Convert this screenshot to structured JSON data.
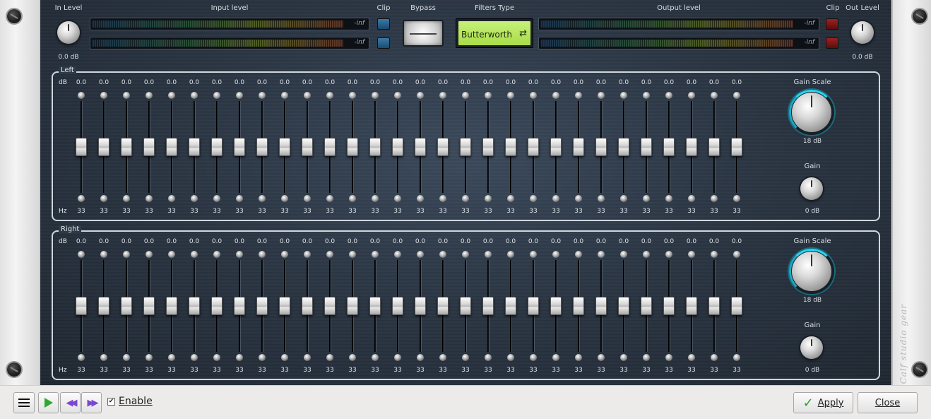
{
  "header": {
    "in_level_label": "In Level",
    "in_level_value": "0.0 dB",
    "input_level_label": "Input level",
    "clip_in_label": "Clip",
    "bypass_label": "Bypass",
    "filters_type_label": "Filters Type",
    "filters_type_value": "Butterworth",
    "output_level_label": "Output level",
    "clip_out_label": "Clip",
    "out_level_label": "Out Level",
    "out_level_value": "0.0 dB",
    "meter_values": [
      "-inf",
      "-inf",
      "-inf",
      "-inf"
    ]
  },
  "colors": {
    "clip_in": "#2f6f9c",
    "clip_out": "#a02020",
    "lcd": "#b6e35c",
    "accent_ring": "#29d4f0"
  },
  "left": {
    "title": "Left",
    "db_unit": "dB",
    "hz_unit": "Hz",
    "gain_values": [
      "0.0",
      "0.0",
      "0.0",
      "0.0",
      "0.0",
      "0.0",
      "0.0",
      "0.0",
      "0.0",
      "0.0",
      "0.0",
      "0.0",
      "0.0",
      "0.0",
      "0.0",
      "0.0",
      "0.0",
      "0.0",
      "0.0",
      "0.0",
      "0.0",
      "0.0",
      "0.0",
      "0.0",
      "0.0",
      "0.0",
      "0.0",
      "0.0",
      "0.0",
      "0.0"
    ],
    "freq_values": [
      "33",
      "33",
      "33",
      "33",
      "33",
      "33",
      "33",
      "33",
      "33",
      "33",
      "33",
      "33",
      "33",
      "33",
      "33",
      "33",
      "33",
      "33",
      "33",
      "33",
      "33",
      "33",
      "33",
      "33",
      "33",
      "33",
      "33",
      "33",
      "33",
      "33"
    ],
    "gain_scale_label": "Gain Scale",
    "gain_scale_value": "18 dB",
    "gain_label": "Gain",
    "gain_value": "0 dB"
  },
  "right": {
    "title": "Right",
    "db_unit": "dB",
    "hz_unit": "Hz",
    "gain_values": [
      "0.0",
      "0.0",
      "0.0",
      "0.0",
      "0.0",
      "0.0",
      "0.0",
      "0.0",
      "0.0",
      "0.0",
      "0.0",
      "0.0",
      "0.0",
      "0.0",
      "0.0",
      "0.0",
      "0.0",
      "0.0",
      "0.0",
      "0.0",
      "0.0",
      "0.0",
      "0.0",
      "0.0",
      "0.0",
      "0.0",
      "0.0",
      "0.0",
      "0.0",
      "0.0"
    ],
    "freq_values": [
      "33",
      "33",
      "33",
      "33",
      "33",
      "33",
      "33",
      "33",
      "33",
      "33",
      "33",
      "33",
      "33",
      "33",
      "33",
      "33",
      "33",
      "33",
      "33",
      "33",
      "33",
      "33",
      "33",
      "33",
      "33",
      "33",
      "33",
      "33",
      "33",
      "33"
    ],
    "gain_scale_label": "Gain Scale",
    "gain_scale_value": "18 dB",
    "gain_label": "Gain",
    "gain_value": "0 dB"
  },
  "branding": {
    "text": "Calf studio gear"
  },
  "footer": {
    "enable_label": "Enable",
    "enable_checked": true,
    "apply_label": "Apply",
    "close_label": "Close",
    "icons": [
      "menu-icon",
      "play-icon",
      "previous-preset-icon",
      "next-preset-icon",
      "check-icon"
    ]
  }
}
